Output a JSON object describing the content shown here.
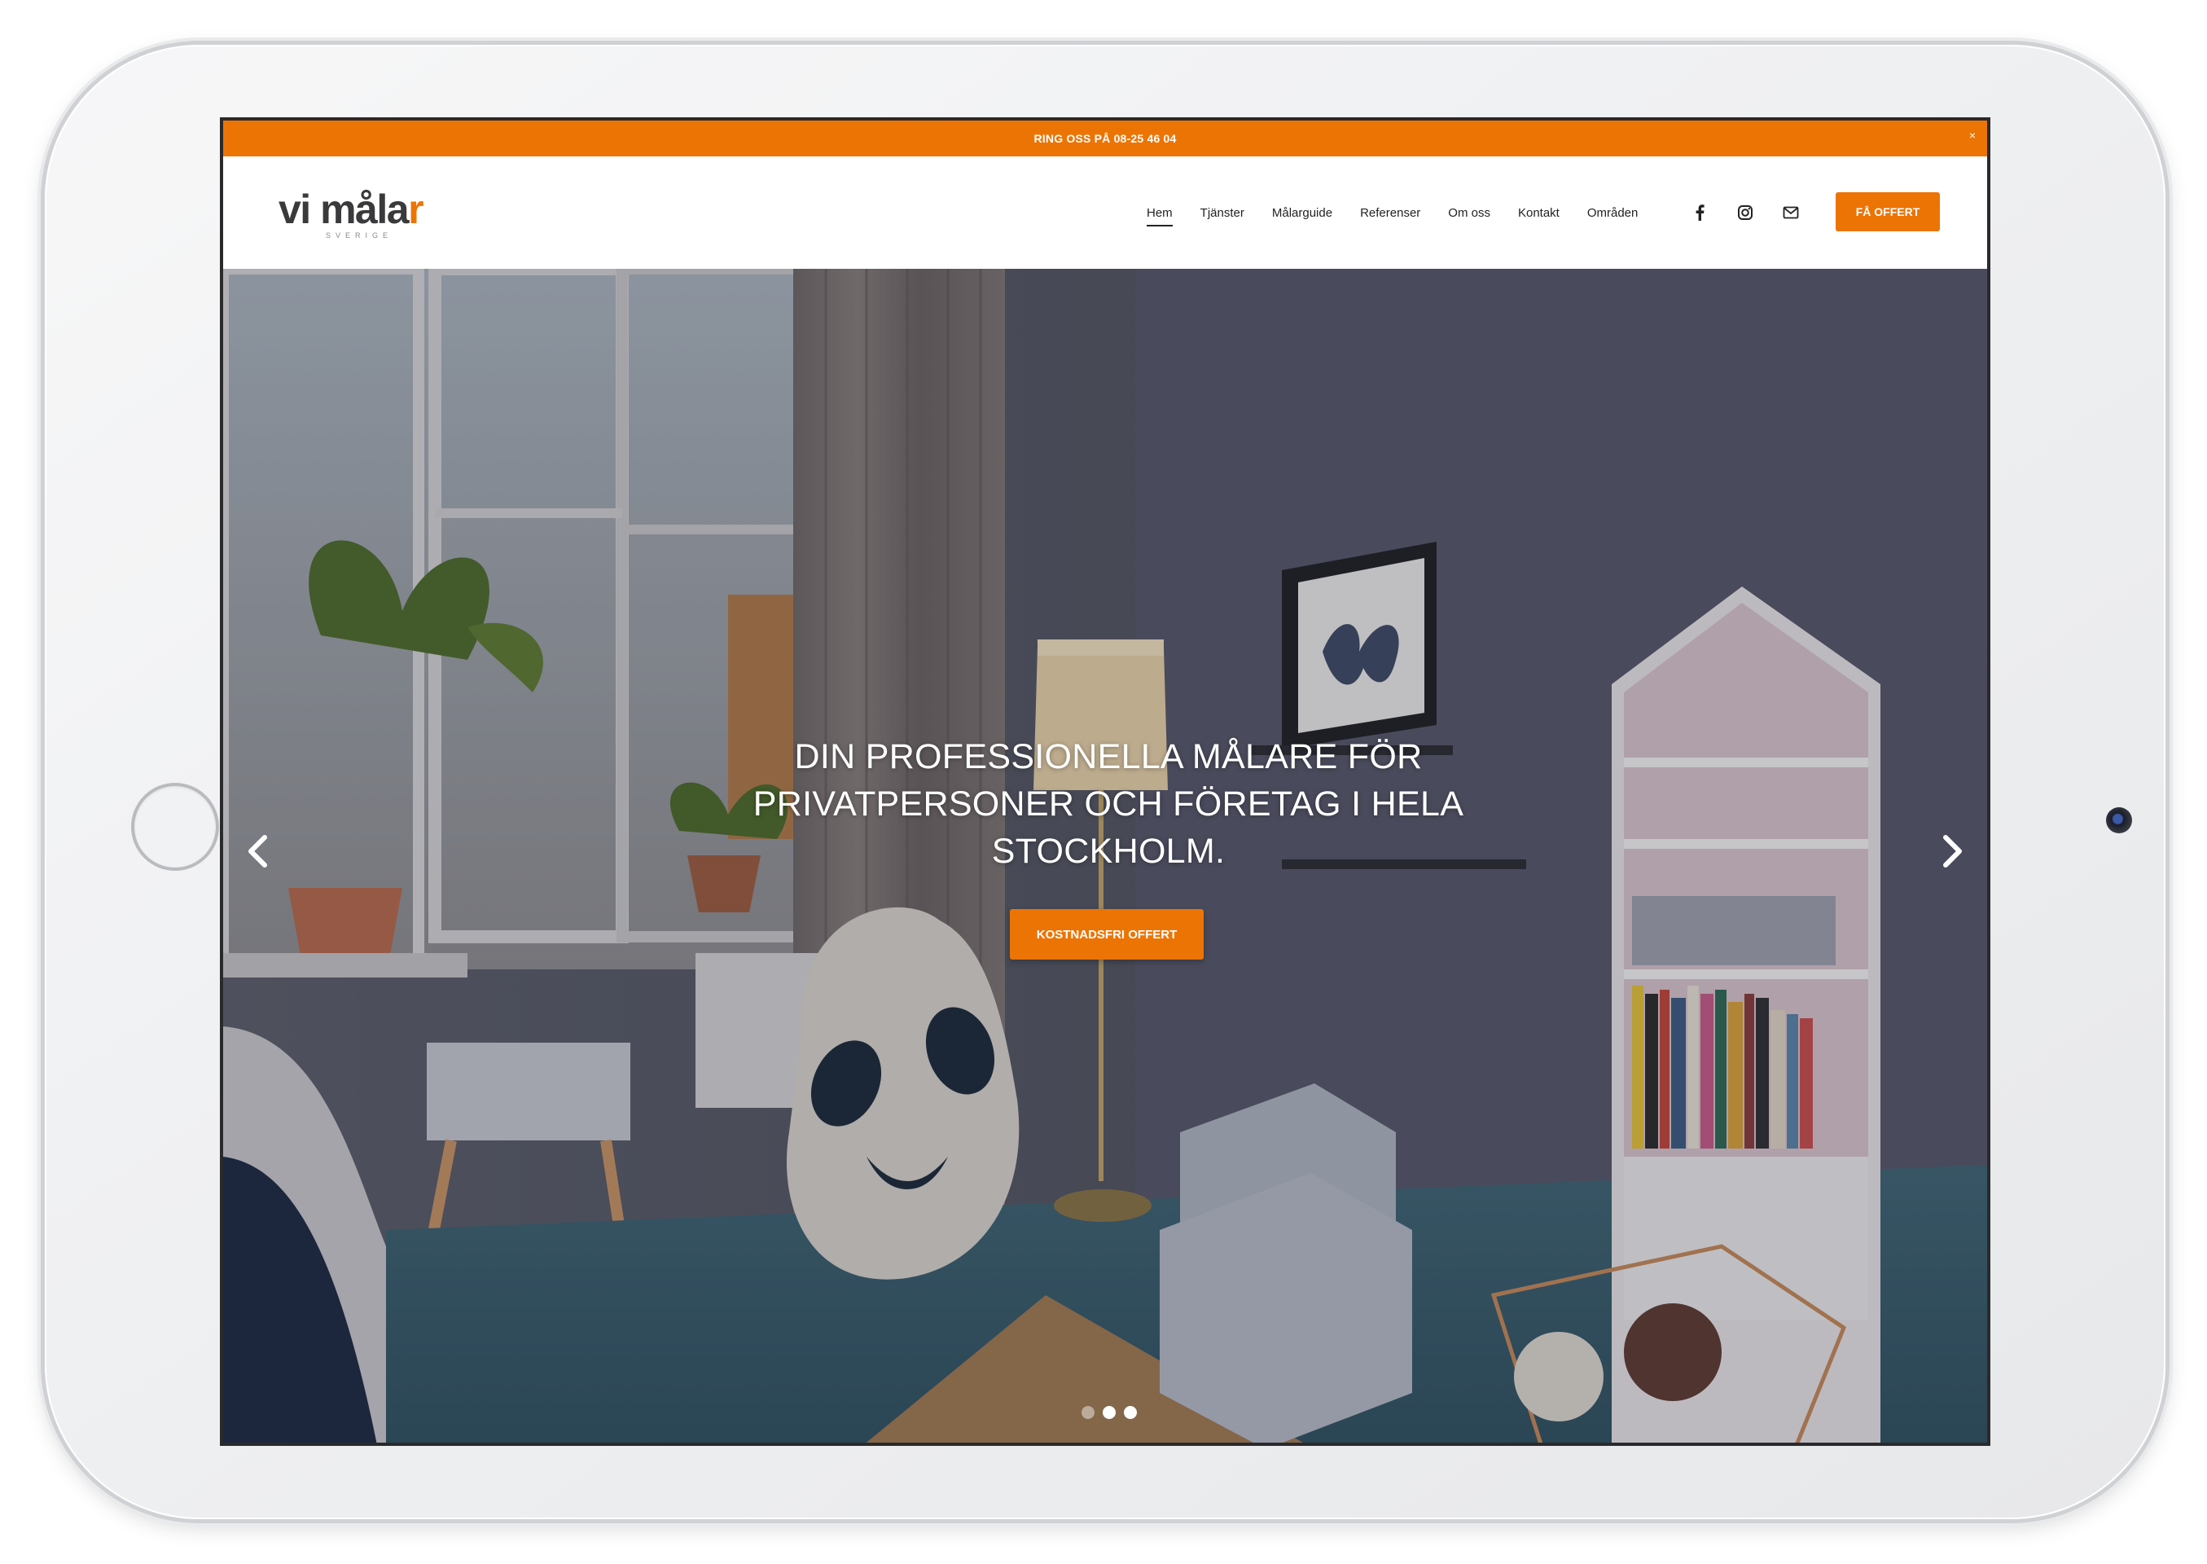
{
  "topbar": {
    "text": "RING OSS PÅ 08-25 46 04",
    "close": "×"
  },
  "logo": {
    "main_a": "vi måla",
    "main_b": "r",
    "sub": "SVERIGE"
  },
  "nav": {
    "items": [
      {
        "label": "Hem",
        "active": true
      },
      {
        "label": "Tjänster"
      },
      {
        "label": "Målarguide"
      },
      {
        "label": "Referenser"
      },
      {
        "label": "Om oss"
      },
      {
        "label": "Kontakt"
      },
      {
        "label": "Områden"
      }
    ],
    "social_icons": [
      "facebook-icon",
      "instagram-icon",
      "mail-icon"
    ],
    "cta_label": "FÅ OFFERT"
  },
  "hero": {
    "title": "DIN PROFESSIONELLA MÅLARE FÖR PRIVATPERSONER OCH FÖRETAG I HELA STOCKHOLM.",
    "cta_label": "KOSTNADSFRI OFFERT",
    "slides_total": 3,
    "active_slide": 2
  },
  "colors": {
    "accent": "#ec7405",
    "text": "#222222",
    "background": "#ffffff"
  }
}
